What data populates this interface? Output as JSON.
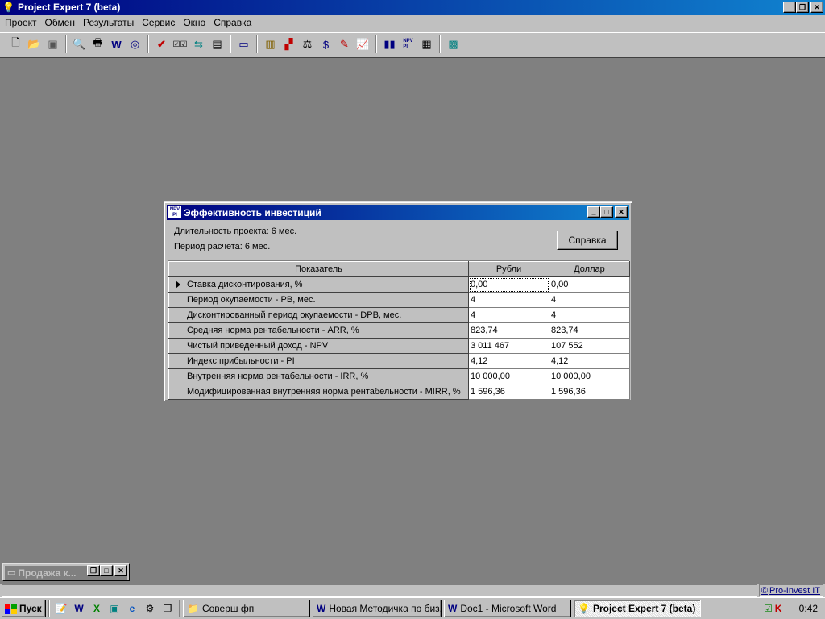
{
  "window": {
    "title": "Project Expert 7 (beta)"
  },
  "menu": [
    "Проект",
    "Обмен",
    "Результаты",
    "Сервис",
    "Окно",
    "Справка"
  ],
  "dialog": {
    "title": "Эффективность инвестиций",
    "duration": "Длительность проекта: 6 мес.",
    "period": "Период расчета: 6 мес.",
    "help_button": "Справка",
    "columns": [
      "Показатель",
      "Рубли",
      "Доллар"
    ],
    "rows": [
      {
        "label": "Ставка дисконтирования, %",
        "rub": "0,00",
        "usd": "0,00"
      },
      {
        "label": "Период окупаемости - PB, мес.",
        "rub": "4",
        "usd": "4"
      },
      {
        "label": "Дисконтированный период окупаемости - DPB, мес.",
        "rub": "4",
        "usd": "4"
      },
      {
        "label": "Средняя норма рентабельности - ARR, %",
        "rub": "823,74",
        "usd": "823,74"
      },
      {
        "label": "Чистый приведенный доход - NPV",
        "rub": "3 011 467",
        "usd": "107 552"
      },
      {
        "label": "Индекс прибыльности - PI",
        "rub": "4,12",
        "usd": "4,12"
      },
      {
        "label": "Внутренняя норма рентабельности - IRR, %",
        "rub": "10 000,00",
        "usd": "10 000,00"
      },
      {
        "label": "Модифицированная внутренняя норма рентабельности - MIRR, %",
        "rub": "1 596,36",
        "usd": "1 596,36"
      }
    ]
  },
  "minimized_window": {
    "title": "Продажа к..."
  },
  "status": {
    "link": "Pro-Invest IT"
  },
  "taskbar": {
    "start": "Пуск",
    "tasks": [
      {
        "label": "Соверш фп"
      },
      {
        "label": "Новая Методичка по биз..."
      },
      {
        "label": "Doc1 - Microsoft Word"
      },
      {
        "label": "Project Expert 7 (beta)"
      }
    ],
    "clock": "0:42"
  },
  "colors": {
    "titlebar": "#000080",
    "desktop_mdi": "#808080",
    "face": "#c0c0c0"
  }
}
